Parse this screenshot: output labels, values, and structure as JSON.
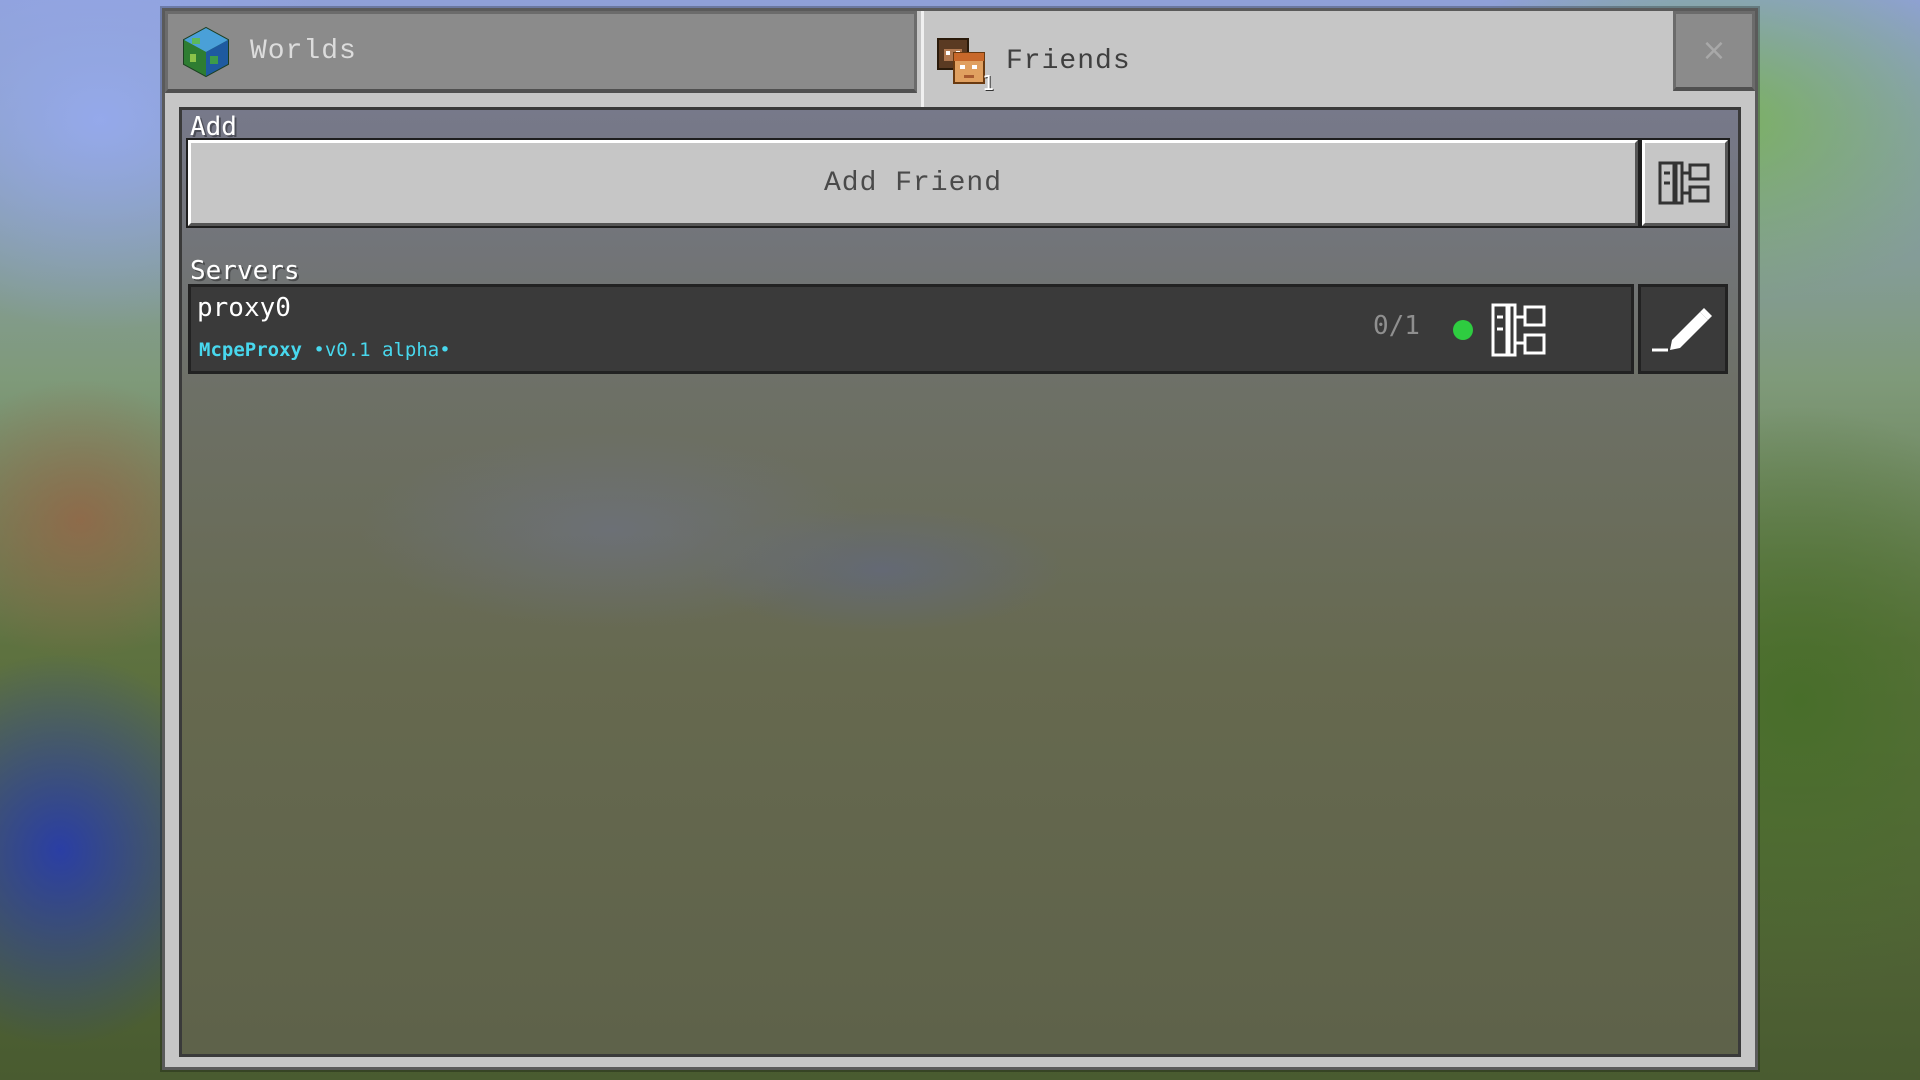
{
  "tabs": {
    "worlds": {
      "label": "Worlds",
      "icon": "globe-icon"
    },
    "friends": {
      "label": "Friends",
      "icon": "friends-icon",
      "badge": "1",
      "active": true
    }
  },
  "close_label": "×",
  "sections": {
    "add": {
      "title": "Add",
      "add_friend_label": "Add Friend"
    },
    "servers": {
      "title": "Servers",
      "items": [
        {
          "name": "proxy0",
          "motd_brand": "McpeProxy",
          "motd_version": " •v0.1 alpha•",
          "players": "0/1",
          "status": "online",
          "status_color": "#2ecc40"
        }
      ]
    }
  },
  "colors": {
    "panel": "#c6c6c6",
    "row_dark": "#3a3a3a",
    "motd": "#48d8ee",
    "online": "#2ecc40"
  }
}
